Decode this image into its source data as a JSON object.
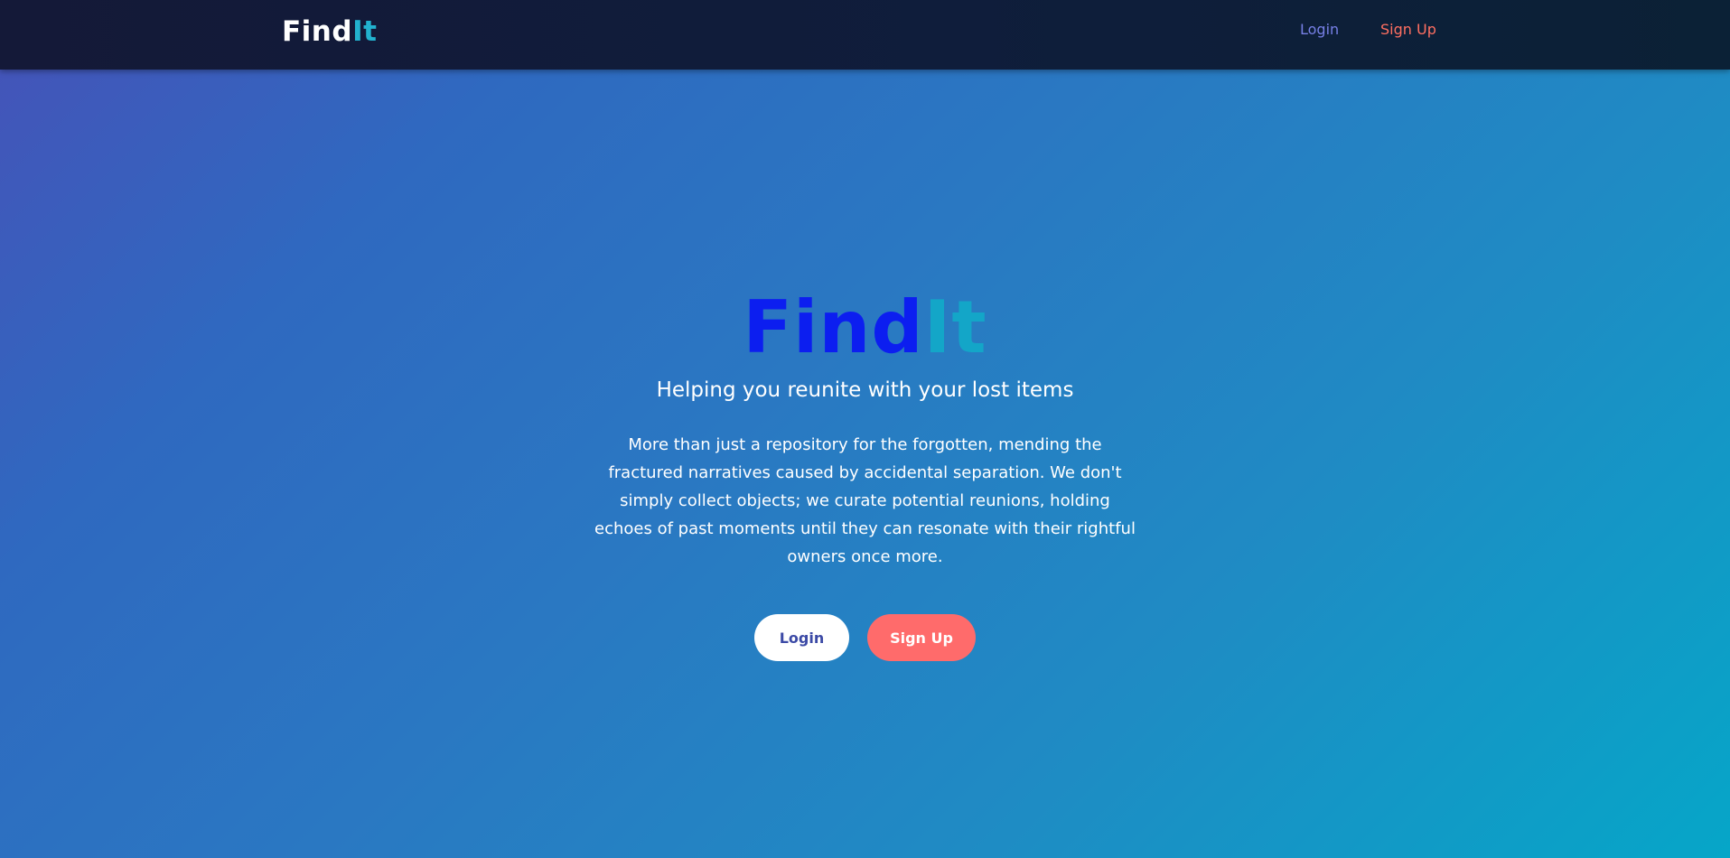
{
  "navbar": {
    "logo": {
      "part_a": "Find",
      "part_b": "It"
    },
    "links": {
      "login": "Login",
      "signup": "Sign Up"
    }
  },
  "hero": {
    "title": {
      "part_a": "Find",
      "part_b": "It"
    },
    "subtitle": "Helping you reunite with your lost items",
    "description": "More than just a repository for the forgotten, mending the fractured narratives caused by accidental separation. We don't simply collect objects; we curate potential reunions, holding echoes of past moments until they can resonate with their rightful owners once more.",
    "buttons": {
      "login": "Login",
      "signup": "Sign Up"
    }
  },
  "colors": {
    "navbar_bg": "#121a39",
    "logo_accent": "#22b2cf",
    "nav_login": "#7780e6",
    "nav_signup": "#ff6f61",
    "title_primary": "#0c1ef0",
    "title_accent": "#13a6c8",
    "button_login_bg": "#ffffff",
    "button_login_text": "#3c4aa6",
    "button_signup_bg": "#ff6b6b",
    "gradient_start": "#4652b8",
    "gradient_end": "#06a6c8"
  }
}
